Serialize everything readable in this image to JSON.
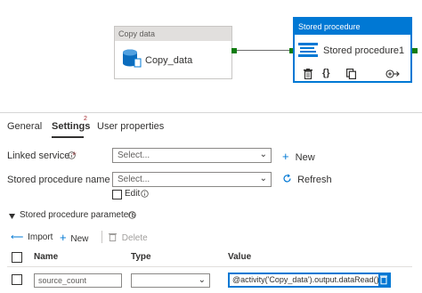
{
  "canvas": {
    "copy_activity": {
      "header": "Copy data",
      "name": "Copy_data"
    },
    "sp_activity": {
      "header": "Stored procedure",
      "name": "Stored procedure1"
    }
  },
  "tabs": [
    {
      "label": "General"
    },
    {
      "label": "Settings",
      "badge": "2",
      "active": true
    },
    {
      "label": "User properties"
    }
  ],
  "form": {
    "linked_service": {
      "label": "Linked service",
      "required": "*",
      "placeholder": "Select...",
      "new_label": "New"
    },
    "stored_procedure_name": {
      "label": "Stored procedure name",
      "required": "*",
      "placeholder": "Select...",
      "refresh_label": "Refresh",
      "edit_label": "Edit"
    }
  },
  "params": {
    "title": "Stored procedure parameters",
    "toolbar": {
      "import": "Import",
      "new": "New",
      "delete": "Delete"
    },
    "columns": [
      "Name",
      "Type",
      "Value"
    ],
    "rows": [
      {
        "name": "source_count",
        "type": "",
        "value": "@activity('Copy_data').output.dataRead()"
      }
    ]
  },
  "colors": {
    "accent": "#0078d4",
    "required": "#a4262c",
    "port": "#107c10"
  }
}
